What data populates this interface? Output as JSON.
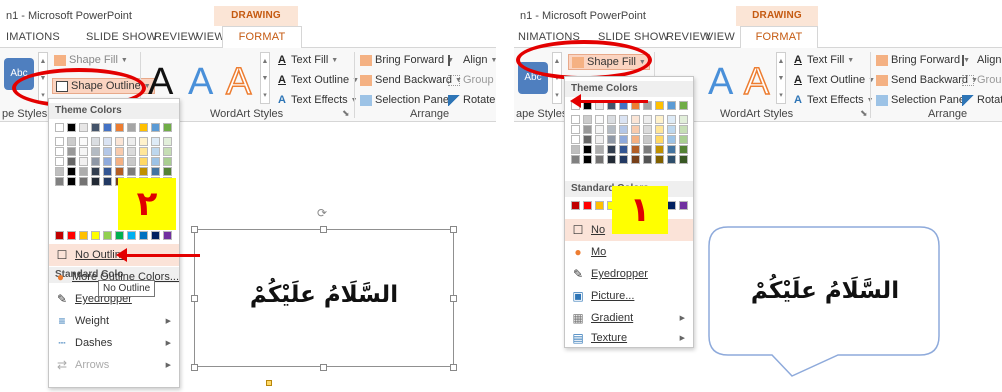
{
  "left": {
    "title": "n1 - Microsoft PowerPoint",
    "context_tab": "DRAWING TOOLS",
    "tabs": [
      "IMATIONS",
      "SLIDE SHOW",
      "REVIEW",
      "VIEW"
    ],
    "active_tab": "FORMAT",
    "shape_fill_label": "Shape Fill",
    "shape_outline_label": "Shape Outline",
    "abc_label": "Abc",
    "text_fill": "Text Fill",
    "text_outline": "Text Outline",
    "text_effects": "Text Effects",
    "bring_forward": "Bring Forward",
    "send_backward": "Send Backward",
    "selection_pane": "Selection Pane",
    "align": "Align",
    "group": "Group",
    "rotate": "Rotate",
    "group_labels": {
      "shape_styles": "pe Styles",
      "wordart_styles": "WordArt Styles",
      "arrange": "Arrange"
    },
    "menu": {
      "theme_header": "Theme Colors",
      "standard_header": "Standard Colo",
      "no_outline": "No Outline",
      "more_colors": "More Outline Colors...",
      "eyedropper": "Eyedropper",
      "weight": "Weight",
      "dashes": "Dashes",
      "arrows": "Arrows"
    },
    "tooltip": "No Outline",
    "badge": "٢",
    "shape_text": "السَّلَامُ علَيْكُمْ"
  },
  "right": {
    "title": "n1 - Microsoft PowerPoint",
    "context_tab": "DRAWING TOOLS",
    "tabs": [
      "NIMATIONS",
      "SLIDE SHOW",
      "REVIEW",
      "VIEW"
    ],
    "active_tab": "FORMAT",
    "shape_fill_label": "Shape Fill",
    "abc_label": "Abc",
    "text_fill": "Text Fill",
    "text_outline": "Text Outline",
    "text_effects": "Text Effects",
    "bring_forward": "Bring Forward",
    "send_backward": "Send Backward",
    "selection_pane": "Selection Pane",
    "align": "Align",
    "group": "Group",
    "rotate": "Rotate",
    "group_labels": {
      "shape_styles": "ape Styles",
      "wordart_styles": "WordArt Styles",
      "arrange": "Arrange"
    },
    "menu": {
      "theme_header": "Theme Colors",
      "standard_header": "Standard Colors",
      "no_fill": "No",
      "more_colors": "Mo",
      "eyedropper": "Eyedropper",
      "picture": "Picture...",
      "gradient": "Gradient",
      "texture": "Texture"
    },
    "badge": "١",
    "shape_text": "السَّلَامُ علَيْكُمْ"
  },
  "colors": {
    "accent_orange": "#c55a11",
    "annotation_red": "#e30000",
    "badge_yellow": "#ffff00",
    "theme_columns": [
      "#ffffff",
      "#000000",
      "#e7e6e6",
      "#44546a",
      "#4472c4",
      "#ed7d31",
      "#a5a5a5",
      "#ffc000",
      "#5b9bd5",
      "#70ad47"
    ],
    "standard_colors": [
      "#c00000",
      "#ff0000",
      "#ffc000",
      "#ffff00",
      "#92d050",
      "#00b050",
      "#00b0f0",
      "#0070c0",
      "#002060",
      "#7030a0"
    ]
  }
}
